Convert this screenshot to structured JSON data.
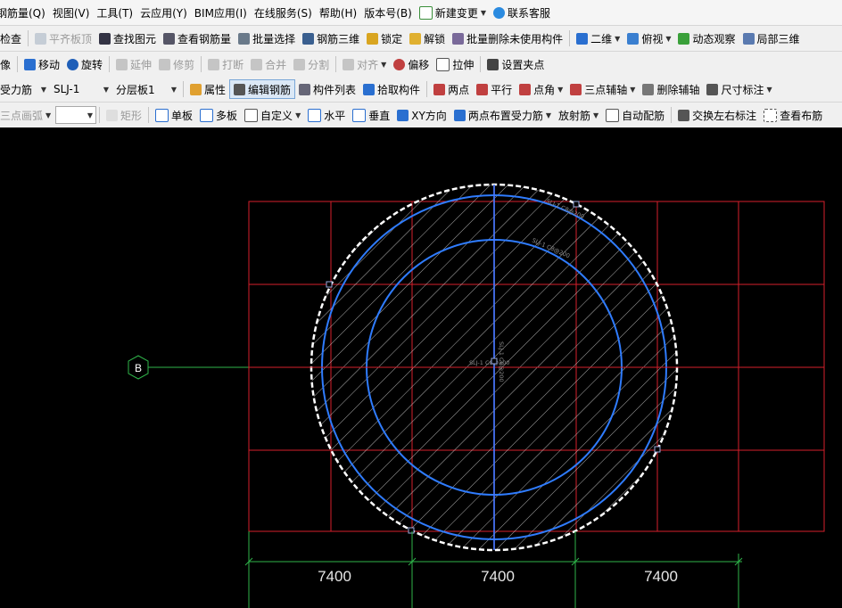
{
  "menu": {
    "items": [
      "钢筋量(Q)",
      "视图(V)",
      "工具(T)",
      "云应用(Y)",
      "BIM应用(I)",
      "在线服务(S)",
      "帮助(H)",
      "版本号(B)",
      "新建变更",
      "联系客服"
    ]
  },
  "toolbar1": {
    "check": "检查",
    "align_top": "平齐板顶",
    "find_elem": "查找图元",
    "view_rebar_qty": "查看钢筋量",
    "batch_select": "批量选择",
    "rebar_3d": "钢筋三维",
    "lock": "锁定",
    "unlock": "解锁",
    "batch_delete": "批量删除未使用构件",
    "view_2d": "二维",
    "view_top": "俯视",
    "dynamic_observe": "动态观察",
    "local_3d": "局部三维"
  },
  "toolbar2": {
    "image": "像",
    "move": "移动",
    "rotate": "旋转",
    "extend": "延伸",
    "trim": "修剪",
    "break": "打断",
    "merge": "合并",
    "split": "分割",
    "align": "对齐",
    "offset": "偏移",
    "stretch": "拉伸",
    "set_grip": "设置夹点"
  },
  "toolbar3": {
    "rebar_type": "受力筋",
    "rebar_name": "SLJ-1",
    "layer": "分层板1",
    "properties": "属性",
    "edit_rebar": "编辑钢筋",
    "component_list": "构件列表",
    "pick_component": "拾取构件",
    "two_points": "两点",
    "parallel": "平行",
    "point_angle": "点角",
    "three_point_axis": "三点辅轴",
    "delete_axis": "删除辅轴",
    "dimension": "尺寸标注"
  },
  "toolbar4": {
    "three_point_arc": "三点画弧",
    "combo_value": "",
    "rectangle": "矩形",
    "single_board": "单板",
    "multi_board": "多板",
    "custom": "自定义",
    "horizontal": "水平",
    "vertical": "垂直",
    "xy_direction": "XY方向",
    "two_point_rebar": "两点布置受力筋",
    "radial_rebar": "放射筋",
    "auto_rebar": "自动配筋",
    "swap_labels": "交换左右标注",
    "view_rebar": "查看布筋"
  },
  "canvas": {
    "axis_label": "B",
    "dimensions": [
      "7400",
      "7400",
      "7400"
    ],
    "rebar_labels": {
      "outer_ring": "SLJ-1 C8@200",
      "inner_ring": "SLJ-1 C8@200",
      "horizontal": "SLJ-1 C8@200",
      "vertical": "SLJ-1 C8@200"
    },
    "colors": {
      "background": "#000000",
      "grid": "#d61f2b",
      "rebar": "#2f7cff",
      "axis": "#2fb54a",
      "center_line": "#d646d6",
      "dimension": "#2fb54a",
      "hatch": "#dcdcdc"
    }
  }
}
